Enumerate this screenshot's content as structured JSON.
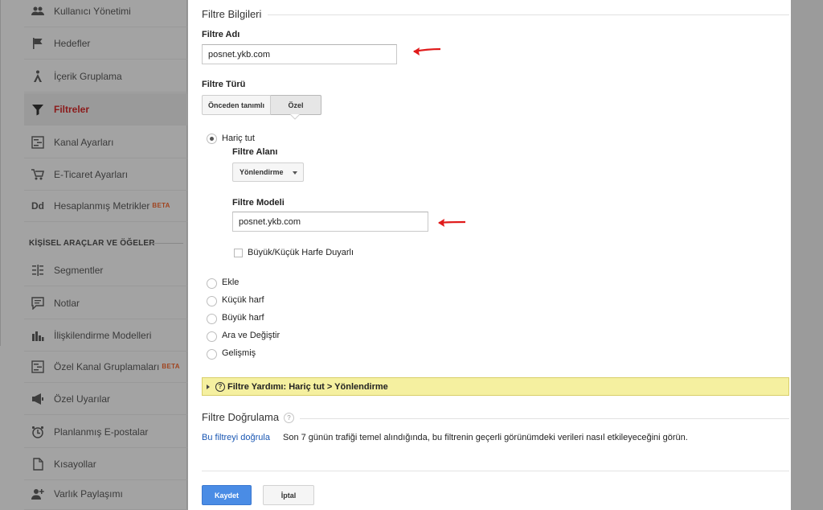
{
  "sidebar": {
    "items": [
      {
        "label": "Kullanıcı Yönetimi",
        "icon": "users-icon"
      },
      {
        "label": "Hedefler",
        "icon": "flag-icon"
      },
      {
        "label": "İçerik Gruplama",
        "icon": "content-grouping-icon"
      },
      {
        "label": "Filtreler",
        "icon": "filter-icon",
        "active": true
      },
      {
        "label": "Kanal Ayarları",
        "icon": "channel-settings-icon"
      },
      {
        "label": "E-Ticaret Ayarları",
        "icon": "cart-icon"
      },
      {
        "label": "Hesaplanmış Metrikler",
        "icon": "calculated-metrics-icon",
        "icon_text": "Dd",
        "badge": "BETA"
      }
    ],
    "section_title": "KİŞİSEL ARAÇLAR VE ÖĞELER",
    "tools": [
      {
        "label": "Segmentler",
        "icon": "segments-icon"
      },
      {
        "label": "Notlar",
        "icon": "notes-icon"
      },
      {
        "label": "İlişkilendirme Modelleri",
        "icon": "attribution-icon"
      },
      {
        "label": "Özel Kanal Gruplamaları",
        "icon": "custom-channel-icon",
        "badge": "BETA"
      },
      {
        "label": "Özel Uyarılar",
        "icon": "megaphone-icon"
      },
      {
        "label": "Planlanmış E-postalar",
        "icon": "clock-icon"
      },
      {
        "label": "Kısayollar",
        "icon": "shortcut-icon"
      },
      {
        "label": "Varlık Paylaşımı",
        "icon": "add-user-icon"
      }
    ]
  },
  "form": {
    "section_title": "Filtre Bilgileri",
    "filter_name_label": "Filtre Adı",
    "filter_name_value": "posnet.ykb.com",
    "filter_type_label": "Filtre Türü",
    "type_predefined": "Önceden tanımlı",
    "type_custom": "Özel",
    "options": {
      "exclude": "Hariç tut",
      "include": "Ekle",
      "lowercase": "Küçük harf",
      "uppercase": "Büyük harf",
      "search_replace": "Ara ve Değiştir",
      "advanced": "Gelişmiş"
    },
    "filter_field_label": "Filtre Alanı",
    "filter_field_value": "Yönlendirme",
    "filter_pattern_label": "Filtre Modeli",
    "filter_pattern_value": "posnet.ykb.com",
    "case_sensitive_label": "Büyük/Küçük Harfe Duyarlı",
    "help_text": "Filtre Yardımı: Hariç tut  >  Yönlendirme",
    "verification_title": "Filtre Doğrulama",
    "verify_link": "Bu filtreyi doğrula",
    "verify_text": "Son 7 günün trafiği temel alındığında, bu filtrenin geçerli görünümdeki verileri nasıl etkileyeceğini görün.",
    "save_label": "Kaydet",
    "cancel_label": "İptal"
  },
  "colors": {
    "accent": "#4a8ce5",
    "active_item": "#8b1a1a",
    "annotation_arrow": "#e01b1b",
    "help_bg": "#f5f0a0"
  }
}
